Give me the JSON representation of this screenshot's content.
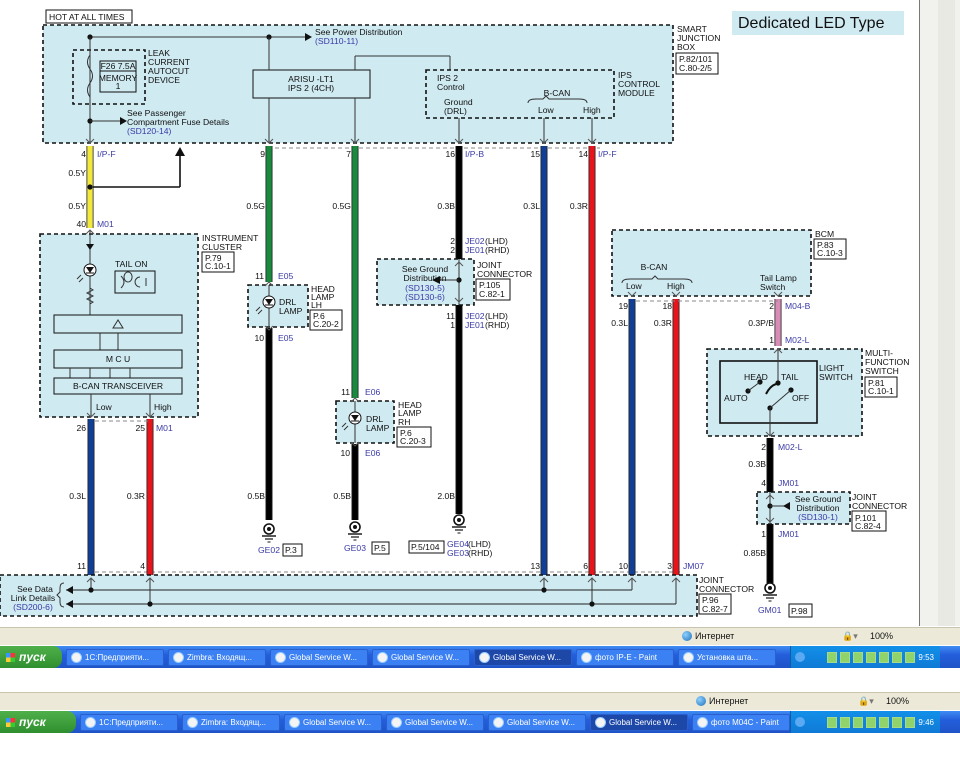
{
  "header": {
    "hot_label": "HOT AT ALL TIMES",
    "title": "Dedicated LED Type"
  },
  "colors": {
    "module_fill": "#cfeaf1",
    "yellow": "#f3e83c",
    "green": "#1b8a3e",
    "black": "#000000",
    "blue": "#123f96",
    "red": "#e8141c",
    "pink": "#d98bb8",
    "ref_blue": "#3a3aa8"
  },
  "sjb": {
    "name": [
      "SMART",
      "JUNCTION",
      "BOX"
    ],
    "ref": [
      "P.82/101",
      "C.80-2/5"
    ],
    "power_note": "See Power Distribution",
    "power_ref": "(SD110-11)",
    "leak": [
      "LEAK",
      "CURRENT",
      "AUTOCUT",
      "DEVICE"
    ],
    "fuse": "F26 7.5A",
    "fuse_name": [
      "MEMORY",
      "1"
    ],
    "pass_note": [
      "See Passenger",
      "Compartment Fuse Details"
    ],
    "pass_ref": "(SD120-14)",
    "ips_box": [
      "ARISU -LT1",
      "IPS 2 (4CH)"
    ],
    "ipsm": {
      "name": [
        "IPS",
        "CONTROL",
        "MODULE"
      ],
      "ctrl": [
        "IPS 2",
        "Control"
      ],
      "ground": [
        "Ground",
        "(DRL)"
      ],
      "bcan": "B-CAN",
      "low": "Low",
      "high": "High"
    }
  },
  "wires": {
    "w1": {
      "pin_top": "4",
      "conn_top": "I/P-F",
      "size_a": "0.5Y",
      "size_b": "0.5Y",
      "pin_bot": "40",
      "conn_bot": "M01"
    },
    "w2": {
      "pin_top": "9",
      "size": "0.5G",
      "pin_in": "11",
      "conn": "E05",
      "pin_out": "10",
      "size_b": "0.5B"
    },
    "w3": {
      "pin_top": "7",
      "size": "0.5G",
      "pin_in": "11",
      "conn": "E06",
      "pin_out": "10",
      "size_b": "0.5B"
    },
    "w4": {
      "pin_top": "16",
      "conn_top": "I/P-B",
      "size": "0.3B",
      "je_top": [
        {
          "pin": "2",
          "conn": "JE02",
          "side": "(LHD)"
        },
        {
          "pin": "2",
          "conn": "JE01",
          "side": "(RHD)"
        }
      ],
      "je_bot": [
        {
          "pin": "11",
          "conn": "JE02",
          "side": "(LHD)"
        },
        {
          "pin": "1",
          "conn": "JE01",
          "side": "(RHD)"
        }
      ],
      "size_b": "2.0B"
    },
    "w5": {
      "pin_top": "15",
      "size": "0.3L",
      "pin_bot": "13"
    },
    "w6": {
      "pin_top": "14",
      "conn_top": "I/P-F",
      "size": "0.3R",
      "pin_bot": "6"
    },
    "ic_low": {
      "pin_top": "26",
      "size": "0.3L",
      "pin_bot": "11"
    },
    "ic_high": {
      "pin_top": "25",
      "conn_top": "M01",
      "size": "0.3R",
      "pin_bot": "4"
    },
    "bcm_low": {
      "pin_top": "19",
      "size": "0.3L",
      "pin_bot": "10"
    },
    "bcm_high": {
      "pin_top": "18",
      "size": "0.3R",
      "pin_bot": "3",
      "conn_bot": "JM07"
    },
    "tail": {
      "pin_top": "2",
      "conn_top": "M04-B",
      "size": "0.3P/B",
      "pin_bot": "1",
      "conn_bot": "M02-L"
    },
    "sw_out": {
      "pin_top": "2",
      "conn_top": "M02-L",
      "size": "0.3B",
      "pin_in": "4",
      "conn_in": "JM01",
      "pin_out": "1",
      "conn_out": "JM01",
      "size_b": "0.85B"
    }
  },
  "joint_je": {
    "note": [
      "See Ground",
      "Distribution"
    ],
    "refs": [
      "(SD130-5)",
      "(SD130-6)"
    ],
    "name": [
      "JOINT",
      "CONNECTOR"
    ],
    "ref": [
      "P.105",
      "C.82-1"
    ]
  },
  "head_lh": {
    "lamp": [
      "DRL",
      "LAMP"
    ],
    "name": [
      "HEAD",
      "LAMP",
      "LH"
    ],
    "ref": [
      "P.6",
      "C.20-2"
    ]
  },
  "head_rh": {
    "lamp": [
      "DRL",
      "LAMP"
    ],
    "name": [
      "HEAD",
      "LAMP",
      "RH"
    ],
    "ref": [
      "P.6",
      "C.20-3"
    ]
  },
  "grounds": {
    "ge02": {
      "name": "GE02",
      "ref": "P.3"
    },
    "ge03": {
      "name": "GE03",
      "ref": "P.5"
    },
    "ge04": {
      "ref": "P.5/104",
      "names": [
        {
          "conn": "GE04",
          "side": "(LHD)"
        },
        {
          "conn": "GE03",
          "side": "(RHD)"
        }
      ]
    },
    "gm01": {
      "name": "GM01",
      "ref": "P.98"
    }
  },
  "cluster": {
    "name": [
      "INSTRUMENT",
      "CLUSTER"
    ],
    "ref": [
      "P.79",
      "C.10-1"
    ],
    "tail_on": "TAIL ON",
    "mcu": "M C U",
    "transceiver": "B-CAN TRANSCEIVER",
    "low": "Low",
    "high": "High"
  },
  "bcm": {
    "name": "BCM",
    "ref": [
      "P.83",
      "C.10-3"
    ],
    "bcan": "B-CAN",
    "low": "Low",
    "high": "High",
    "tail_switch": [
      "Tail Lamp",
      "Switch"
    ]
  },
  "mfs": {
    "name": [
      "MULTI-",
      "FUNCTION",
      "SWITCH"
    ],
    "ref": [
      "P.81",
      "C.10-1"
    ],
    "switch_name": [
      "LIGHT",
      "SWITCH"
    ],
    "head": "HEAD",
    "tail": "TAIL",
    "auto": "AUTO",
    "off": "OFF"
  },
  "joint_jm": {
    "note": [
      "See Ground",
      "Distribution"
    ],
    "ref_note": "(SD130-1)",
    "name": [
      "JOINT",
      "CONNECTOR"
    ],
    "ref": [
      "P.101",
      "C.82-4"
    ]
  },
  "joint_bottom": {
    "note": [
      "See Data",
      "Link Details"
    ],
    "ref_note": "(SD200-6)",
    "name": [
      "JOINT",
      "CONNECTOR"
    ],
    "ref": [
      "P.96",
      "C.82-7"
    ]
  },
  "status1": {
    "zone": "Интернет",
    "zoom": "100%"
  },
  "taskbar1": {
    "start": "пуск",
    "items": [
      "1С:Предприяти...",
      "Zimbra: Входящ...",
      "Global Service W...",
      "Global Service W...",
      "Global Service W...",
      "фото IP-E - Paint",
      "Установка шта..."
    ],
    "active_index": 4,
    "clock": "9:53"
  },
  "status2": {
    "zone": "Интернет",
    "zoom": "100%"
  },
  "taskbar2": {
    "start": "пуск",
    "items": [
      "1С:Предприяти...",
      "Zimbra: Входящ...",
      "Global Service W...",
      "Global Service W...",
      "Global Service W...",
      "Global Service W...",
      "фото M04C - Paint"
    ],
    "active_index": 5,
    "clock": "9:46"
  }
}
